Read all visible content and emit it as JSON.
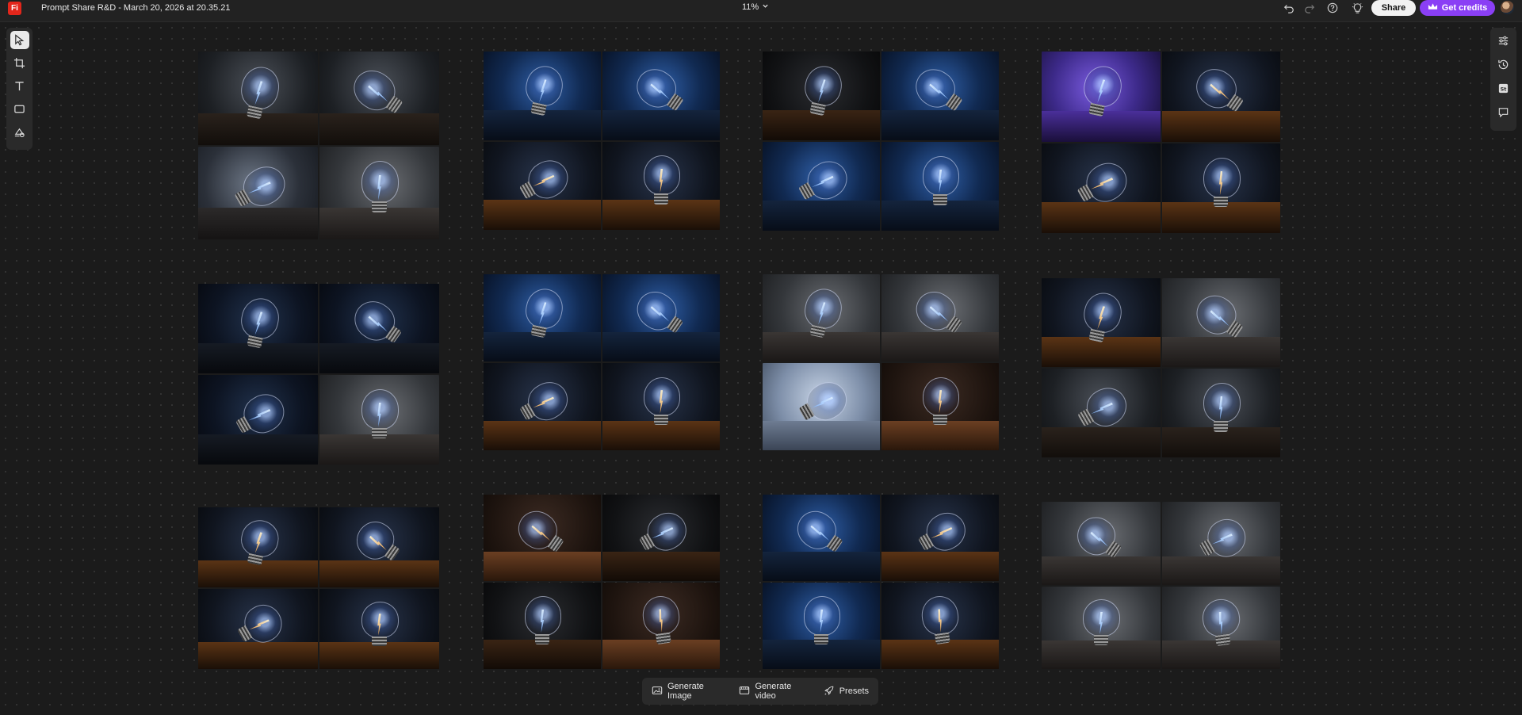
{
  "app": {
    "logo_text": "Fi",
    "document_title": "Prompt Share R&D - March 20, 2026 at 20.35.21",
    "zoom_label": "11%"
  },
  "header_actions": {
    "share_label": "Share",
    "credits_label": "Get credits",
    "icons": [
      "undo-icon",
      "redo-icon",
      "help-icon",
      "lightbulb-icon"
    ]
  },
  "left_tools": [
    "select-tool-icon",
    "crop-frame-icon",
    "text-tool-icon",
    "shape-tool-icon",
    "generative-fill-icon"
  ],
  "right_tools": [
    "adjust-icon",
    "history-icon",
    "stock-icon",
    "comment-icon"
  ],
  "bottom_actions": {
    "generate_image": "Generate Image",
    "generate_video": "Generate video",
    "presets": "Presets"
  },
  "colors": {
    "accent_purple": "#8a3ff5",
    "logo_red": "#e3261b",
    "canvas_bg": "#1b1b1b"
  },
  "image_groups": [
    {
      "id": "g1",
      "tones": [
        "dark-grey",
        "dark-grey",
        "grey-blue",
        "grey"
      ]
    },
    {
      "id": "g2",
      "tones": [
        "blue",
        "blue",
        "orange",
        "orange"
      ]
    },
    {
      "id": "g3",
      "tones": [
        "dark",
        "blue",
        "blue",
        "blue"
      ]
    },
    {
      "id": "g4",
      "tones": [
        "purple",
        "orange",
        "orange",
        "orange"
      ]
    },
    {
      "id": "g5",
      "tones": [
        "dark-blue",
        "dark-blue",
        "dark-blue",
        "grey"
      ]
    },
    {
      "id": "g6",
      "tones": [
        "blue",
        "blue",
        "orange",
        "orange"
      ]
    },
    {
      "id": "g7",
      "tones": [
        "grey",
        "grey",
        "light-blue",
        "wood"
      ]
    },
    {
      "id": "g8",
      "tones": [
        "orange",
        "grey",
        "dark-grey",
        "dark-grey"
      ]
    },
    {
      "id": "g9",
      "tones": [
        "orange",
        "orange",
        "orange",
        "orange"
      ]
    },
    {
      "id": "g10",
      "tones": [
        "wood",
        "dark",
        "dark",
        "wood"
      ]
    },
    {
      "id": "g11",
      "tones": [
        "blue",
        "orange",
        "blue",
        "orange"
      ]
    },
    {
      "id": "g12",
      "tones": [
        "grey",
        "grey",
        "grey",
        "grey"
      ]
    }
  ]
}
